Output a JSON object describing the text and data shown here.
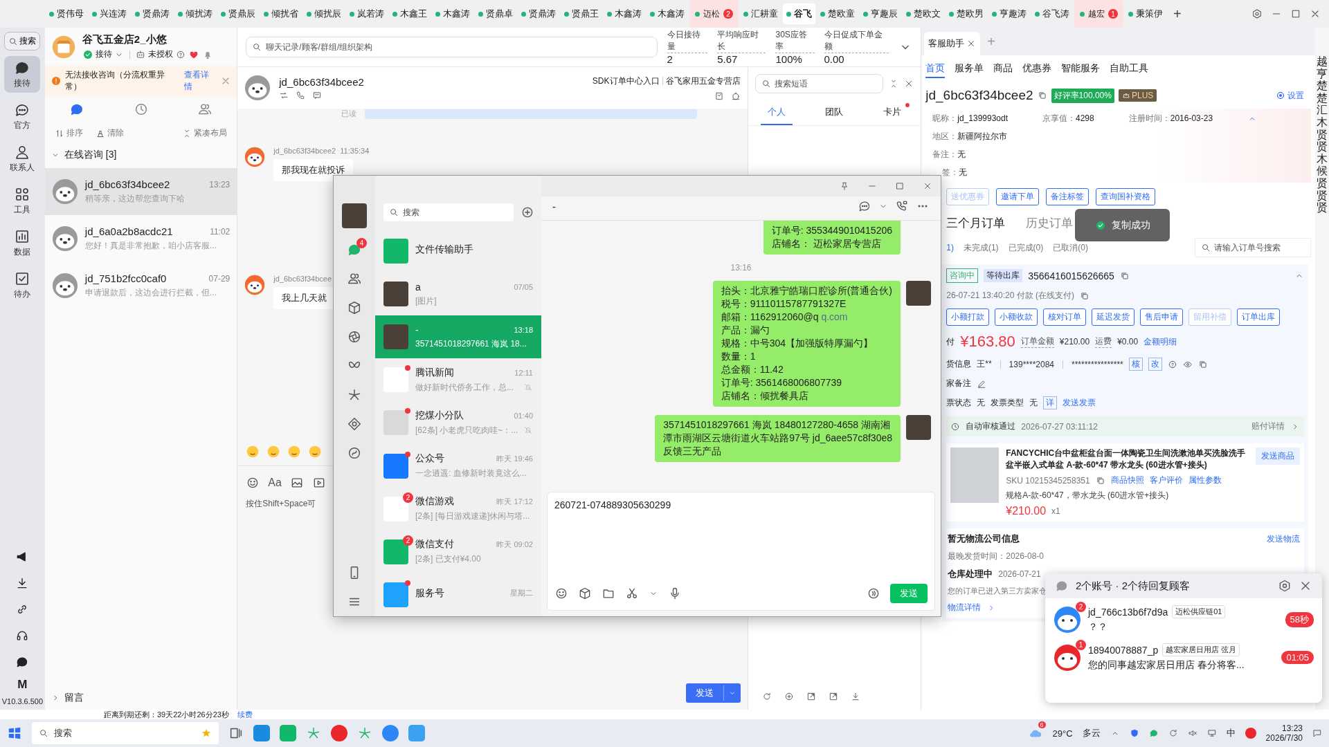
{
  "top_tabs": [
    {
      "label": "贤伟母",
      "color": "#25b37a",
      "selected": false
    },
    {
      "label": "兴连涛",
      "color": "#25b37a",
      "selected": false
    },
    {
      "label": "贤鼎涛",
      "color": "#25b37a",
      "selected": false
    },
    {
      "label": "倾扰涛",
      "color": "#25b37a",
      "selected": false
    },
    {
      "label": "贤鼎辰",
      "color": "#25b37a",
      "selected": false
    },
    {
      "label": "倾扰省",
      "color": "#25b37a",
      "selected": false
    },
    {
      "label": "倾扰辰",
      "color": "#25b37a",
      "selected": false
    },
    {
      "label": "岚若涛",
      "color": "#25b37a",
      "selected": false
    },
    {
      "label": "木鑫王",
      "color": "#25b37a",
      "selected": false
    },
    {
      "label": "木鑫涛",
      "color": "#25b37a",
      "selected": false
    },
    {
      "label": "贤鼎卓",
      "color": "#25b37a",
      "selected": false
    },
    {
      "label": "贤鼎涛",
      "color": "#25b37a",
      "selected": false
    },
    {
      "label": "贤鼎王",
      "color": "#25b37a",
      "selected": false
    },
    {
      "label": "木鑫涛",
      "color": "#25b37a",
      "selected": false
    },
    {
      "label": "木鑫涛",
      "color": "#25b37a",
      "selected": false
    },
    {
      "label": "迈松",
      "color": "#25b37a",
      "selected": false,
      "badge": "2"
    },
    {
      "label": "汇耕童",
      "color": "#25b37a",
      "selected": false
    },
    {
      "label": "谷飞",
      "color": "#25b37a",
      "selected": true
    },
    {
      "label": "楚欧童",
      "color": "#25b37a",
      "selected": false
    },
    {
      "label": "亨趣辰",
      "color": "#25b37a",
      "selected": false
    },
    {
      "label": "楚欧文",
      "color": "#25b37a",
      "selected": false
    },
    {
      "label": "楚欧男",
      "color": "#25b37a",
      "selected": false
    },
    {
      "label": "亨趣涛",
      "color": "#25b37a",
      "selected": false
    },
    {
      "label": "谷飞涛",
      "color": "#25b37a",
      "selected": false
    },
    {
      "label": "越宏",
      "color": "#25b37a",
      "selected": false,
      "badge": "1"
    },
    {
      "label": "秉策伊",
      "color": "#25b37a",
      "selected": false
    }
  ],
  "add_tab": "+",
  "left_rail": {
    "search": "搜索",
    "items": [
      {
        "kind": "reception",
        "label": "接待",
        "selected": true
      },
      {
        "kind": "official",
        "label": "官方",
        "selected": false
      },
      {
        "kind": "contacts",
        "label": "联系人",
        "selected": false
      },
      {
        "kind": "tools",
        "label": "工具",
        "selected": false
      },
      {
        "kind": "data",
        "label": "数据",
        "selected": false
      },
      {
        "kind": "todo",
        "label": "待办",
        "selected": false
      }
    ],
    "logo": "M",
    "version": "V10.3.6.500"
  },
  "shop": {
    "name": "谷飞五金店2_小悠",
    "status": "接待",
    "auth": "未授权"
  },
  "alert": {
    "text": "无法接收咨询（分流权重异常）",
    "link": "查看详情"
  },
  "list_tabs": [
    {
      "kind": "chat",
      "selected": true
    },
    {
      "kind": "history",
      "selected": false
    },
    {
      "kind": "people",
      "selected": false
    }
  ],
  "list_actions": [
    {
      "kind": "sort",
      "label": "排序"
    },
    {
      "kind": "clear",
      "label": "清除"
    },
    {
      "kind": "compact",
      "label": "紧凑布局"
    }
  ],
  "group": {
    "title": "在线咨询 [3]",
    "expanded": true
  },
  "contacts": [
    {
      "name": "jd_6bc63f34bcee2",
      "time": "13:23",
      "preview": "稍等亲，这边帮您查询下哈",
      "selected": true
    },
    {
      "name": "jd_6a0a2b8acdc21",
      "time": "11:02",
      "preview": "您好！真是非常抱歉，咱小店客服...",
      "selected": false
    },
    {
      "name": "jd_751b2fcc0caf0",
      "time": "07-29",
      "preview": "申请退款后，这边会进行拦截，但...",
      "selected": false
    }
  ],
  "leave_message": "留言",
  "expiry": {
    "text": "距离到期还剩：39天22小时26分23秒",
    "link": "续费"
  },
  "chat": {
    "search_placeholder": "聊天记录/顾客/群组/组织架构",
    "stats": [
      {
        "label": "今日接待量",
        "value": "2"
      },
      {
        "label": "平均响应时长",
        "value": "5.67"
      },
      {
        "label": "30S应答率",
        "value": "100%"
      },
      {
        "label": "今日促成下单金额",
        "value": "0.00"
      }
    ],
    "customer": "jd_6bc63f34bcee2",
    "links": [
      "SDK订单中心入口",
      "谷飞家用五金专营店"
    ],
    "read_label": "已读",
    "messages": [
      {
        "sender": "jd_6bc63f34bcee2",
        "time": "11:35:34",
        "text": "那我现在就投诉"
      },
      {
        "sender": "jd_6bc63f34bcee",
        "text": "我上几天就"
      }
    ],
    "font_tool": "Aa",
    "input_placeholder": "按住Shift+Space可",
    "send": "发送"
  },
  "phrases": {
    "search_placeholder": "搜索短语",
    "tabs": [
      {
        "label": "个人",
        "selected": true,
        "dot": false
      },
      {
        "label": "团队",
        "selected": false,
        "dot": false
      },
      {
        "label": "卡片",
        "selected": false,
        "dot": true
      }
    ]
  },
  "helper": {
    "tab": "客服助手",
    "add": "+",
    "nav": [
      {
        "label": "首页",
        "selected": true
      },
      {
        "label": "服务单",
        "selected": false
      },
      {
        "label": "商品",
        "selected": false
      },
      {
        "label": "优惠券",
        "selected": false
      },
      {
        "label": "智能服务",
        "selected": false
      },
      {
        "label": "自助工具",
        "selected": false
      }
    ],
    "customer": "jd_6bc63f34bcee2",
    "rating": "好评率100.00%",
    "plus": "PLUS",
    "settings": {
      "label": "设置",
      "checked": true
    },
    "info_rows": [
      [
        {
          "label": "昵称：",
          "value": "jd_139993odt"
        },
        {
          "label": "京享值：",
          "value": "4298"
        },
        {
          "label": "注册时间：",
          "value": "2016-03-23"
        }
      ],
      [
        {
          "label": "地区：",
          "value": "新疆阿拉尔市"
        }
      ],
      [
        {
          "label": "备注：",
          "value": "无"
        }
      ],
      [
        {
          "label": "签：",
          "value": "无"
        }
      ]
    ],
    "actions": [
      {
        "label": "送优惠券",
        "disabled": true
      },
      {
        "label": "邀请下单",
        "disabled": false
      },
      {
        "label": "备注标签",
        "disabled": false
      },
      {
        "label": "查询国补资格",
        "disabled": false
      }
    ],
    "order_tabs": [
      {
        "label": "三个月订单",
        "selected": true
      },
      {
        "label": "历史订单",
        "selected": false
      }
    ],
    "order_filters": [
      {
        "label": "1)",
        "selected": true
      },
      {
        "label": "未完成(1)",
        "selected": false
      },
      {
        "label": "已完成(0)",
        "selected": false
      },
      {
        "label": "已取消(0)",
        "selected": false
      }
    ],
    "order_search_placeholder": "请输入订单号搜索",
    "order": {
      "tags": [
        {
          "label": "咨询中",
          "kind": "outline"
        },
        {
          "label": "等待出库",
          "kind": "fill"
        }
      ],
      "number": "3566416015626665",
      "paid": "26-07-21 13:40:20  付款  (在线支付)",
      "buttons": [
        {
          "label": "小额打款",
          "disabled": false
        },
        {
          "label": "小额收款",
          "disabled": false
        },
        {
          "label": "核对订单",
          "disabled": false
        },
        {
          "label": "延迟发货",
          "disabled": false
        },
        {
          "label": "售后申请",
          "disabled": false
        },
        {
          "label": "留用补偿",
          "disabled": true
        },
        {
          "label": "订单出库",
          "disabled": false
        }
      ],
      "pay_label": "付",
      "amount": "¥163.80",
      "total_label": "订单金额",
      "total": "¥210.00",
      "freight_label": "运费",
      "freight": "¥0.00",
      "detail_link": "金额明细",
      "receiver_label": "货信息",
      "receiver": "王**",
      "phone": "139****2084",
      "address": "****************",
      "verify": "核",
      "edit": "改",
      "note_label": "家备注",
      "invoice_status_label": "票状态",
      "invoice_status": "无",
      "invoice_type_label": "发票类型",
      "invoice_type": "无",
      "invoice_detail": "详",
      "send_invoice": "发送发票",
      "audit": "自动审核通过",
      "audit_time": "2026-07-27 03:11:12",
      "compensation": "赔付详情"
    },
    "product": {
      "title": "FANCYCHIC台中盆柜盆台面一体陶瓷卫生间洗漱池单买洗脸洗手盆半嵌入式单盆 A-款-60*47 带水龙头 (60进水管+接头)",
      "send": "发送商品",
      "sku": "SKU 10215345258351",
      "links": [
        "商品快照",
        "客户评价",
        "属性参数"
      ],
      "spec": "规格A-款-60*47，带水龙头 (60进水管+接头)",
      "price": "¥210.00",
      "qty": "x1"
    },
    "logistics": {
      "title": "暂无物流公司信息",
      "send": "发送物流",
      "deadline": "最晚发货时间：2026-08-0",
      "status": "仓库处理中",
      "status_time": "2026-07-21",
      "note": "您的订单已进入第三方卖家仓",
      "detail": "物流详情"
    }
  },
  "toast": {
    "text": "复制成功"
  },
  "edge_strip": {
    "text": "越亨楚楚汇木贤贤木候贤贤贤"
  },
  "wechat": {
    "chats_badge": "4",
    "search_placeholder": "搜索",
    "chats": [
      {
        "kind": "file",
        "name": "文件传输助手",
        "selected": false,
        "muted": false
      },
      {
        "kind": "photo",
        "name": "a",
        "time": "07/05",
        "preview": "[图片]",
        "selected": false,
        "muted": false
      },
      {
        "kind": "photo",
        "name": "-",
        "time": "13:18",
        "preview": "3571451018297661  海岚 18...",
        "selected": true,
        "muted": false
      },
      {
        "kind": "news",
        "name": "腾讯新闻",
        "time": "12:11",
        "preview": "做好新时代侨务工作，总...",
        "selected": false,
        "muted": true,
        "dot": true
      },
      {
        "kind": "group",
        "name": "挖煤小分队",
        "time": "01:40",
        "preview": "[62条] 小老虎只吃肉哇~：...",
        "selected": false,
        "muted": true,
        "dot": true
      },
      {
        "kind": "official",
        "name": "公众号",
        "time": "昨天 19:46",
        "preview": "一念逍遥: 血修新时装竟这么...",
        "selected": false,
        "muted": false,
        "dot": true
      },
      {
        "kind": "game",
        "name": "微信游戏",
        "time": "昨天 17:12",
        "preview": "[2条] [每日游戏速递]休闲与塔...",
        "selected": false,
        "muted": false,
        "badge": "2"
      },
      {
        "kind": "pay",
        "name": "微信支付",
        "time": "昨天 09:02",
        "preview": "[2条] 已支付¥4.00",
        "selected": false,
        "muted": false,
        "badge": "2"
      },
      {
        "kind": "service",
        "name": "服务号",
        "time": "星期二",
        "selected": false,
        "muted": false,
        "dot": true
      }
    ],
    "chat_title": "-",
    "messages": [
      {
        "kind": "bubble",
        "lines": [
          {
            "text": "订单号: 3553449010415206"
          },
          {
            "text": "店铺名：  迈松家居专营店"
          }
        ]
      },
      {
        "kind": "time",
        "text": "13:16"
      },
      {
        "kind": "bubble",
        "lines": [
          {
            "text": "抬头：北京雅宁皓瑞口腔诊所(普通合伙)"
          },
          {
            "text": "税号：91110115787791327E"
          },
          {
            "text": "邮箱：1162912060@q",
            "link": "q.com"
          },
          {
            "text": "产品：漏勺"
          },
          {
            "text": "规格：中号304【加强版特厚漏勺】"
          },
          {
            "text": "数量：1"
          },
          {
            "text": "总金额：11.42"
          },
          {
            "text": "订单号: 3561468006807739"
          },
          {
            "text": "店铺名：倾扰餐具店"
          }
        ]
      },
      {
        "kind": "bubble",
        "lines": [
          {
            "text": "3571451018297661  海岚 18480127280-4658 湖南湘"
          },
          {
            "text": "潭市雨湖区云塘街道火车站路97号   jd_6aee57c8f30e8"
          },
          {
            "text": "反馈三无产品"
          }
        ]
      }
    ],
    "input": "260721-074889305630299",
    "send": "发送"
  },
  "popup": {
    "title": "2个账号 · 2个待回复顾客",
    "items": [
      {
        "name": "jd_766c13b6f7d9a",
        "badge": "2",
        "tag": "迈松供应链01",
        "message": "？？",
        "timer": "58秒",
        "color": "#2f86f6"
      },
      {
        "name": "18940078887_p",
        "badge": "1",
        "tag": "越宏家居日用店 弦月",
        "message": "您的同事越宏家居日用店 春分将客...",
        "timer": "01:05",
        "color": "#e8262b"
      }
    ]
  },
  "taskbar": {
    "search_placeholder": "搜索",
    "weather_badge": "6",
    "temperature": "29°C",
    "weather": "多云",
    "ime": "中",
    "time": "13:23",
    "date": "2026/7/30"
  }
}
